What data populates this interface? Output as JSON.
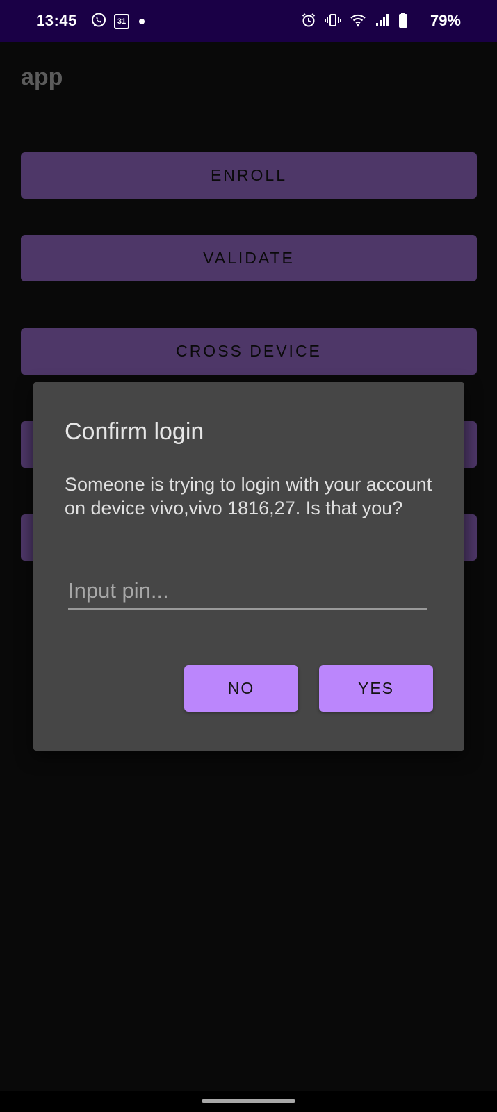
{
  "status_bar": {
    "time": "13:45",
    "calendar_day": "31",
    "battery_percent": "79%",
    "icons_left": [
      "whatsapp-icon",
      "calendar-icon",
      "notification-dot-icon"
    ],
    "icons_right": [
      "alarm-icon",
      "vibrate-icon",
      "wifi-icon",
      "signal-icon",
      "battery-icon"
    ]
  },
  "app_bar": {
    "title": "app"
  },
  "main": {
    "buttons": [
      {
        "label": "ENROLL"
      },
      {
        "label": "VALIDATE"
      },
      {
        "label": "CROSS DEVICE"
      },
      {
        "label": ""
      },
      {
        "label": ""
      }
    ],
    "button_color": "#4e3768"
  },
  "dialog": {
    "title": "Confirm login",
    "message": "Someone is trying to login with your account on device vivo,vivo 1816,27. Is that you?",
    "pin_input": {
      "value": "",
      "placeholder": "Input pin..."
    },
    "no_label": "NO",
    "yes_label": "YES",
    "accent_color": "#bb86fc",
    "background_color": "#464646"
  },
  "colors": {
    "status_bar_bg": "#1a0046",
    "screen_bg": "#090909"
  }
}
